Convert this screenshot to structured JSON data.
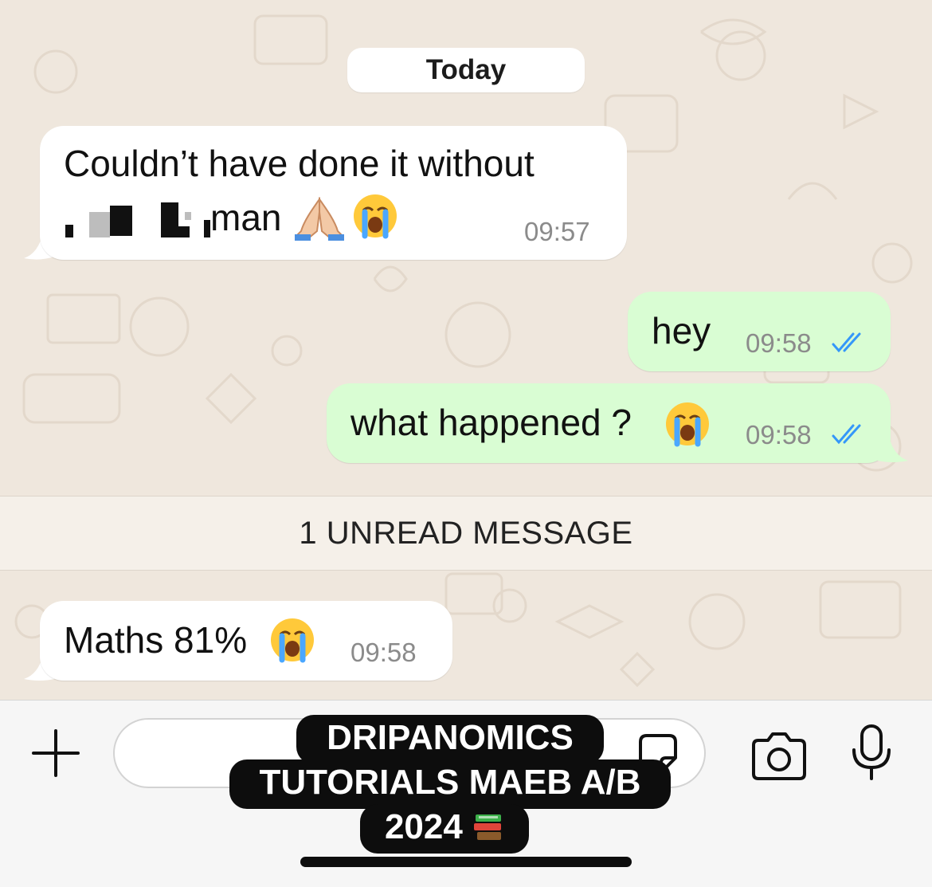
{
  "chat": {
    "date_label": "Today",
    "messages": [
      {
        "direction": "incoming",
        "line1": "Couldn’t have done it without",
        "line2": "man",
        "emojis": [
          "folded-hands",
          "loudly-crying-face"
        ],
        "time": "09:57"
      },
      {
        "direction": "outgoing",
        "text": "hey",
        "time": "09:58",
        "status": "read"
      },
      {
        "direction": "outgoing",
        "text": "what happened ?",
        "emojis": [
          "loudly-crying-face"
        ],
        "time": "09:58",
        "status": "read"
      },
      {
        "direction": "incoming",
        "text": "Maths 81%",
        "emojis": [
          "loudly-crying-face"
        ],
        "time": "09:58"
      }
    ],
    "unread_divider": "1 UNREAD MESSAGE"
  },
  "composer": {
    "attach_icon": "plus-icon",
    "sticker_icon": "sticker-icon",
    "camera_icon": "camera-icon",
    "mic_icon": "microphone-icon",
    "input_value": ""
  },
  "overlay_caption": {
    "line1": "DRIPANOMICS",
    "line2": "TUTORIALS MAEB A/B",
    "line3": "2024",
    "emoji": "books"
  },
  "colors": {
    "wallpaper": "#efe7dd",
    "incoming_bubble": "#ffffff",
    "outgoing_bubble": "#d9fdd3",
    "read_ticks": "#3497f9"
  }
}
